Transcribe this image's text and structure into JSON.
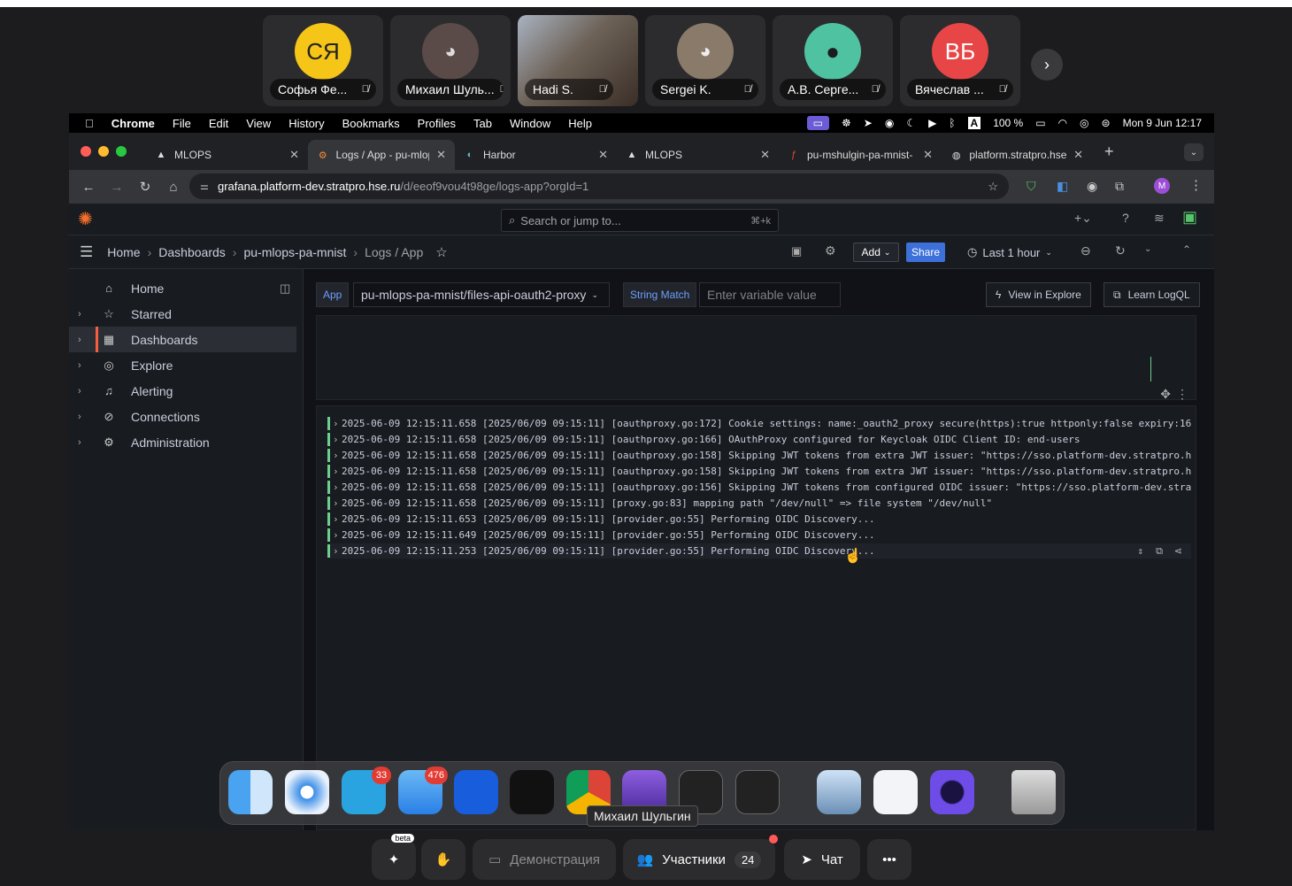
{
  "call": {
    "participants": [
      {
        "initials": "СЯ",
        "name": "Софья Фе...",
        "avatar_color": "#f5c518"
      },
      {
        "initials": "",
        "name": "Михаил Шуль...",
        "avatar_color": "#5a4a48"
      },
      {
        "initials": "",
        "name": "Hadi S.",
        "avatar_color": "#6d5a4a"
      },
      {
        "initials": "",
        "name": "Sergei K.",
        "avatar_color": "#8a7a6a"
      },
      {
        "initials": "",
        "name": "А.В. Серге...",
        "avatar_color": "#4fc3a1"
      },
      {
        "initials": "ВБ",
        "name": "Вячеслав ...",
        "avatar_color": "#e84646"
      }
    ],
    "next_label": "›",
    "controls": {
      "ai_badge": "beta",
      "screen_share": "Демонстрация",
      "participants_label": "Участники",
      "participants_count": "24",
      "chat": "Чат",
      "more": "•••"
    },
    "tooltip": "Михаил Шульгин"
  },
  "macos": {
    "menu": [
      "Chrome",
      "File",
      "Edit",
      "View",
      "History",
      "Bookmarks",
      "Profiles",
      "Tab",
      "Window",
      "Help"
    ],
    "battery": "100 %",
    "clock": "Mon 9 Jun  12:17"
  },
  "browser": {
    "tabs": [
      {
        "title": "MLOPS",
        "active": false
      },
      {
        "title": "Logs / App - pu-mlops-",
        "active": true
      },
      {
        "title": "Harbor",
        "active": false
      },
      {
        "title": "MLOPS",
        "active": false
      },
      {
        "title": "pu-mshulgin-pa-mnist-",
        "active": false
      },
      {
        "title": "platform.stratpro.hse.ru",
        "active": false
      }
    ],
    "url_host": "grafana.platform-dev.stratpro.hse.ru",
    "url_path": "/d/eeof9vou4t98ge/logs-app?orgId=1",
    "profile_initial": "M"
  },
  "grafana": {
    "search_placeholder": "Search or jump to...",
    "search_shortcut": "⌘+k",
    "breadcrumb": [
      "Home",
      "Dashboards",
      "pu-mlops-pa-mnist",
      "Logs / App"
    ],
    "add_label": "Add",
    "share_label": "Share",
    "time_range": "Last 1 hour",
    "nav": [
      "Home",
      "Starred",
      "Dashboards",
      "Explore",
      "Alerting",
      "Connections",
      "Administration"
    ],
    "variables": {
      "app_label": "App",
      "app_value": "pu-mlops-pa-mnist/files-api-oauth2-proxy",
      "match_label": "String Match",
      "match_placeholder": "Enter variable value"
    },
    "view_in_explore": "View in Explore",
    "learn_logql": "Learn LogQL",
    "logs": [
      "2025-06-09 12:15:11.658 [2025/06/09 09:15:11] [oauthproxy.go:172] Cookie settings: name:_oauth2_proxy secure(https):true httponly:false expiry:16",
      "2025-06-09 12:15:11.658 [2025/06/09 09:15:11] [oauthproxy.go:166] OAuthProxy configured for Keycloak OIDC Client ID: end-users",
      "2025-06-09 12:15:11.658 [2025/06/09 09:15:11] [oauthproxy.go:158] Skipping JWT tokens from extra JWT issuer: \"https://sso.platform-dev.stratpro.h",
      "2025-06-09 12:15:11.658 [2025/06/09 09:15:11] [oauthproxy.go:158] Skipping JWT tokens from extra JWT issuer: \"https://sso.platform-dev.stratpro.h",
      "2025-06-09 12:15:11.658 [2025/06/09 09:15:11] [oauthproxy.go:156] Skipping JWT tokens from configured OIDC issuer: \"https://sso.platform-dev.stra",
      "2025-06-09 12:15:11.658 [2025/06/09 09:15:11] [proxy.go:83] mapping path \"/dev/null\" => file system \"/dev/null\"",
      "2025-06-09 12:15:11.653 [2025/06/09 09:15:11] [provider.go:55] Performing OIDC Discovery...",
      "2025-06-09 12:15:11.649 [2025/06/09 09:15:11] [provider.go:55] Performing OIDC Discovery...",
      "2025-06-09 12:15:11.253 [2025/06/09 09:15:11] [provider.go:55] Performing OIDC Discovery..."
    ]
  },
  "dock": {
    "telegram_badge": "33",
    "mail_badge": "476"
  }
}
